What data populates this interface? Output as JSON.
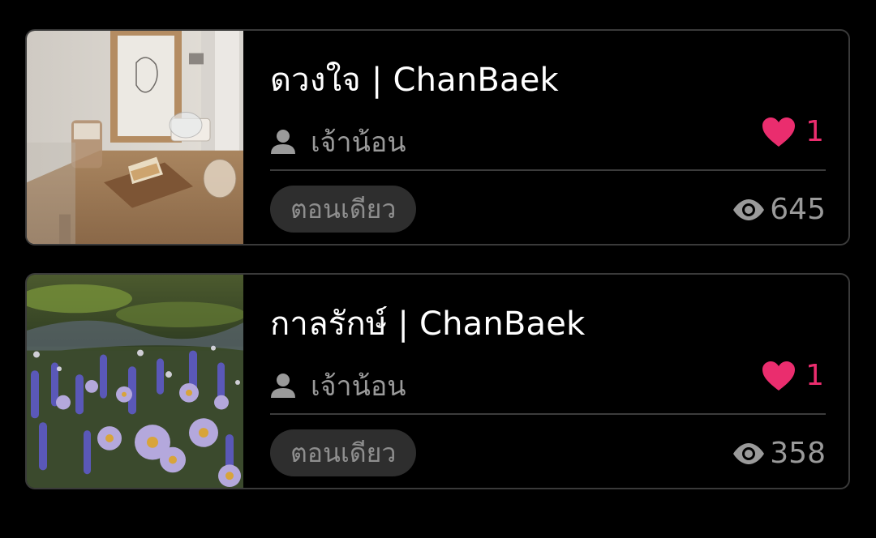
{
  "colors": {
    "background": "#000000",
    "card_border": "#3a3a3a",
    "title_text": "#ffffff",
    "muted_text": "#9a9a9a",
    "like_accent": "#ea2d6e",
    "badge_background": "#2e2e2e"
  },
  "stories": [
    {
      "title": "ดวงใจ | ChanBaek",
      "author": "เจ้าน้อน",
      "likes": "1",
      "status": "ตอนเดียว",
      "views": "645",
      "cover_icon": "cafe-table-photo"
    },
    {
      "title": "กาลรักษ์ | ChanBaek",
      "author": "เจ้าน้อน",
      "likes": "1",
      "status": "ตอนเดียว",
      "views": "358",
      "cover_icon": "wildflower-meadow-photo"
    }
  ],
  "icons": {
    "author": "user-icon",
    "likes": "heart-icon",
    "views": "eye-icon"
  }
}
